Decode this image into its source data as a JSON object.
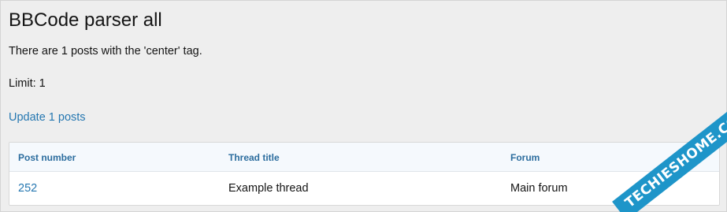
{
  "page": {
    "title": "BBCode parser all",
    "summary": "There are 1 posts with the 'center' tag.",
    "limit": "Limit: 1",
    "update_link": "Update 1 posts"
  },
  "table": {
    "headers": [
      "Post number",
      "Thread title",
      "Forum"
    ],
    "rows": [
      [
        "252",
        "Example thread",
        "Main forum"
      ]
    ]
  },
  "watermark": {
    "text": "TECHIESHOME.COM"
  },
  "colors": {
    "link": "#2577b1",
    "header_text": "#2c6d9e",
    "watermark": "#1e95c9"
  }
}
